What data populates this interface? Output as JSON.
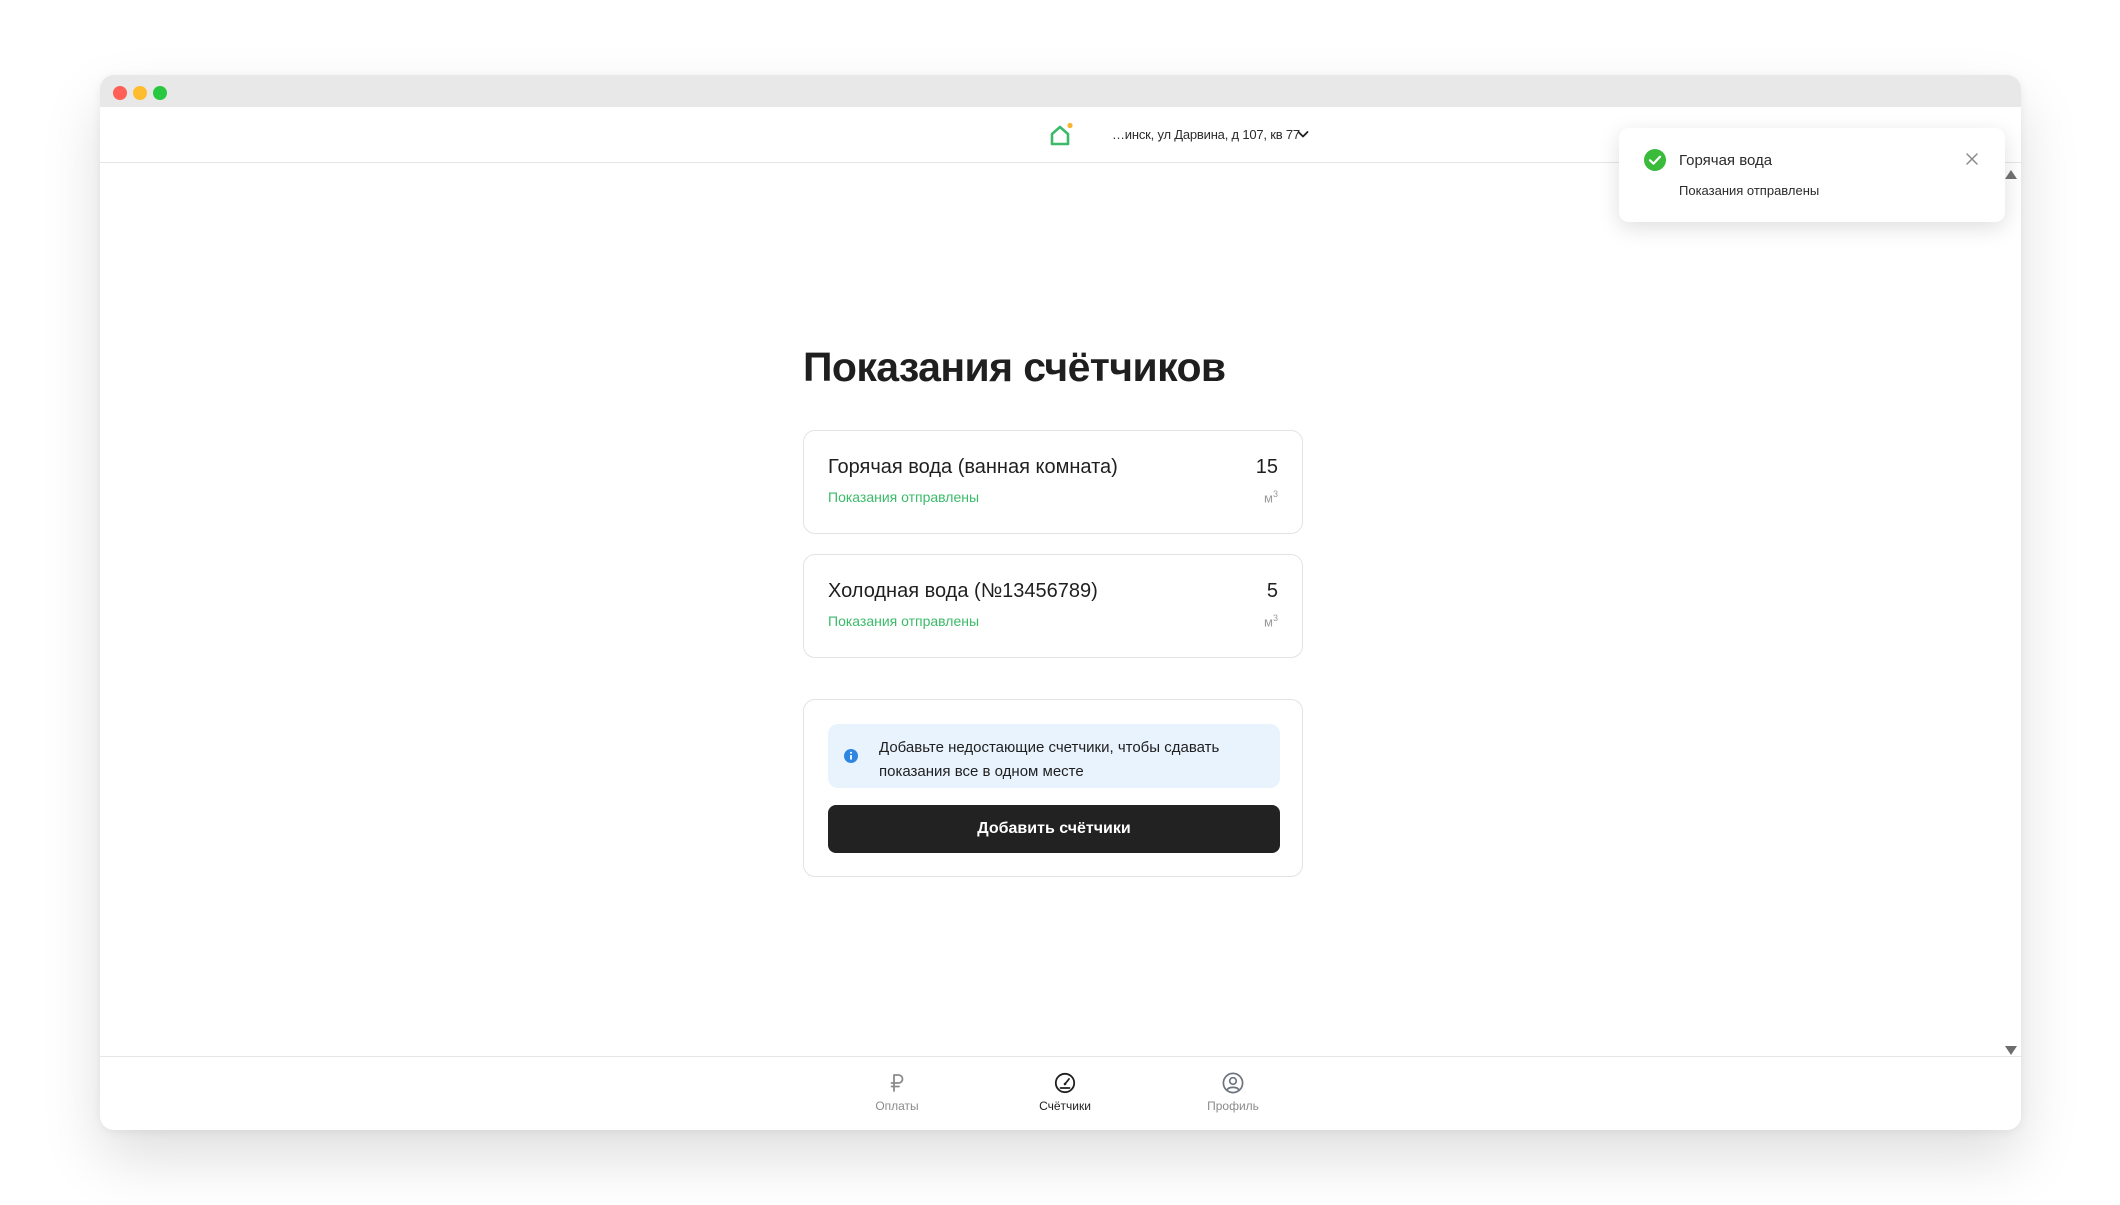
{
  "header": {
    "address": "…инск, ул Дарвина, д 107, кв 77"
  },
  "page": {
    "title": "Показания счётчиков"
  },
  "meters": [
    {
      "name": "Горячая вода (ванная комната)",
      "status": "Показания отправлены",
      "value": "15",
      "unit": "м",
      "unit_sup": "3"
    },
    {
      "name": "Холодная вода (№13456789)",
      "status": "Показания отправлены",
      "value": "5",
      "unit": "м",
      "unit_sup": "3"
    }
  ],
  "add_card": {
    "info_text": "Добавьте недостающие счетчики, чтобы сдавать показания все в одном месте",
    "button_label": "Добавить счётчики"
  },
  "toast": {
    "title": "Горячая вода",
    "message": "Показания отправлены"
  },
  "bottom_nav": [
    {
      "label": "Оплаты",
      "icon": "ruble-icon",
      "active": false
    },
    {
      "label": "Счётчики",
      "icon": "meter-gauge-icon",
      "active": true
    },
    {
      "label": "Профиль",
      "icon": "profile-icon",
      "active": false
    }
  ],
  "colors": {
    "accent_green": "#3bbb6a",
    "button_dark": "#222222",
    "info_bg": "#e9f3fd",
    "info_icon": "#2f86e0"
  }
}
